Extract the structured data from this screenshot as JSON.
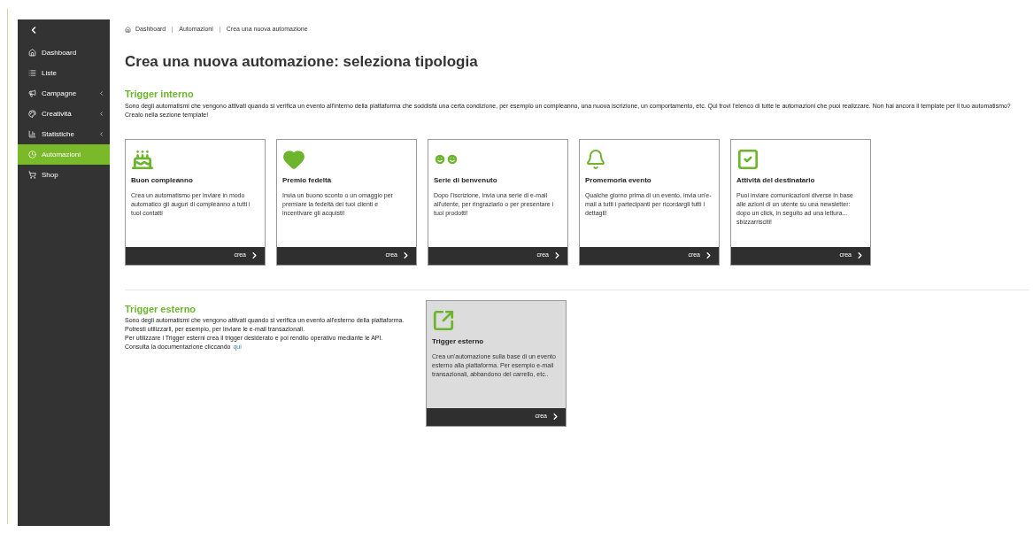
{
  "sidebar": {
    "items": [
      {
        "kind": "home",
        "label": "Dashboard",
        "has_submenu": false,
        "selected": false
      },
      {
        "kind": "list",
        "label": "Liste",
        "has_submenu": false,
        "selected": false
      },
      {
        "kind": "megaphone",
        "label": "Campagne",
        "has_submenu": true,
        "selected": false
      },
      {
        "kind": "palette",
        "label": "Creatività",
        "has_submenu": true,
        "selected": false
      },
      {
        "kind": "chart",
        "label": "Statistiche",
        "has_submenu": true,
        "selected": false
      },
      {
        "kind": "clock",
        "label": "Automazioni",
        "has_submenu": false,
        "selected": true
      },
      {
        "kind": "cart",
        "label": "Shop",
        "has_submenu": false,
        "selected": false
      }
    ]
  },
  "breadcrumb": [
    "Dashboard",
    "Automazioni",
    "Crea una nuova automazione"
  ],
  "title": "Crea una nuova automazione: seleziona tipologia",
  "internal": {
    "heading": "Trigger interno",
    "description": "Sono degli automatismi che vengono attivati quando si verifica un evento all'interno della piattaforma che soddisfa una certa condizione, per esempio un compleanno, una nuova iscrizione, un comportamento, etc. Qui trovi l'elenco di tutte le automazioni che puoi realizzare. Non hai ancora il template per il tuo automatismo? Crealo nella sezione template!",
    "cards": [
      {
        "kind": "cake",
        "title": "Buon compleanno",
        "text": "Crea un automatismo per inviare in modo automatico gli auguri di compleanno a tutti i tuoi contatti",
        "action": "crea",
        "highlighted": false
      },
      {
        "kind": "hearts",
        "title": "Premio fedeltà",
        "text": "Invia un buono sconto o un omaggio per premiare la fedeltà dei tuoi clienti e incentivare gli acquisti!",
        "action": "crea",
        "highlighted": false
      },
      {
        "kind": "smileys",
        "title": "Serie di benvenuto",
        "text": "Dopo l'iscrizione, invia una serie di e-mail all'utente, per ringraziarlo o per presentare i tuoi prodotti!",
        "action": "crea",
        "highlighted": false
      },
      {
        "kind": "bell",
        "title": "Promemoria evento",
        "text": "Qualche giorno prima di un evento, invia un'e-mail a tutti i partecipanti per ricordargli tutti i dettagli!",
        "action": "crea",
        "highlighted": false
      },
      {
        "kind": "check",
        "title": "Attività del destinatario",
        "text": "Puoi inviare comunicazioni diverse in base alle azioni di un utente su una newsletter: dopo un click, in seguito ad una lettura... sbizzarrisciti!",
        "action": "crea",
        "highlighted": false
      }
    ]
  },
  "external": {
    "heading": "Trigger esterno",
    "lines": [
      "Sono degli automatismi che vengono attivati quando si verifica un evento all'esterno della piattaforma.",
      "Potresti utilizzarli, per esempio, per inviare le e-mail transazionali.",
      "Per utilizzare i Trigger esterni crea il trigger desiderato e poi rendilo operativo mediante le API."
    ],
    "link_line": "Consulta la documentazione cliccando",
    "link": "qui",
    "cards": [
      {
        "kind": "external",
        "title": "Trigger esterno",
        "text": "Crea un'automazione sulla base di un evento esterno alla piattaforma. Per esempio e-mail transazionali, abbandono del carrello, etc..",
        "action": "crea",
        "highlighted": true
      }
    ]
  }
}
